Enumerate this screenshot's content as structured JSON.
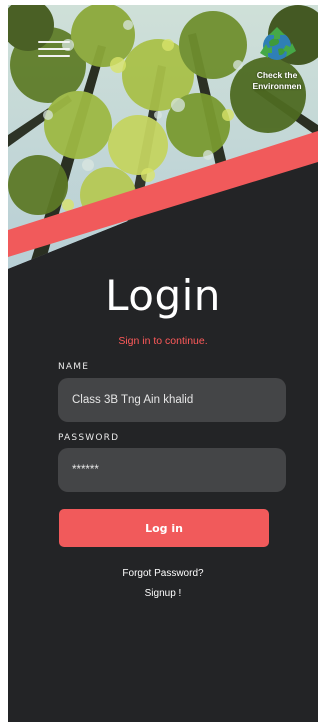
{
  "header": {
    "menu_icon": "hamburger-menu-icon",
    "brand_logo_icon": "recycle-globe-icon",
    "brand_text": "Check the Environmen"
  },
  "login": {
    "title": "Login",
    "subtitle": "Sign in to continue.",
    "name_label": "NAME",
    "name_value": "Class 3B Tng Ain khalid",
    "password_label": "PASSWORD",
    "password_value": "******",
    "login_button_label": "Log in",
    "forgot_password_label": "Forgot Password?",
    "signup_label": "Signup !"
  },
  "colors": {
    "background": "#232426",
    "accent": "#f15a5b",
    "subtitle": "#ff5a5a",
    "field": "#444547"
  }
}
